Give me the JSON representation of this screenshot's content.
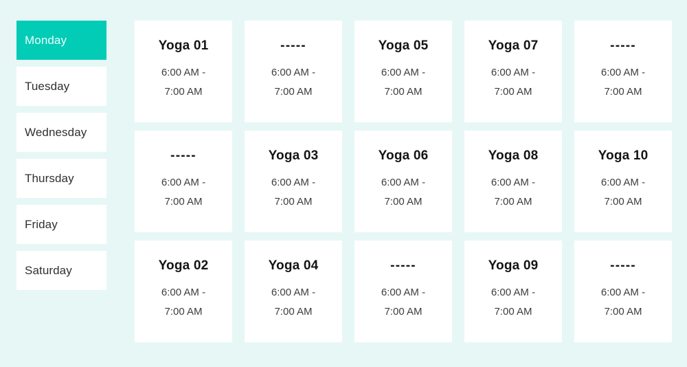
{
  "theme": {
    "background": "#e6f7f6",
    "accent": "#02cbb6",
    "card_background": "#ffffff",
    "title_color": "#131416",
    "time_color": "#3b3d40",
    "active_tab_text": "#eafffc"
  },
  "daybar": {
    "name": "day-selector",
    "selected": "Monday",
    "days": [
      {
        "label": "Monday",
        "active": true
      },
      {
        "label": "Tuesday",
        "active": false
      },
      {
        "label": "Wednesday",
        "active": false
      },
      {
        "label": "Thursday",
        "active": false
      },
      {
        "label": "Friday",
        "active": false
      },
      {
        "label": "Saturday",
        "active": false
      }
    ]
  },
  "schedule": {
    "name": "class-schedule-grid",
    "columns": 5,
    "rows": 3,
    "empty_label": "-----",
    "default_time": "6:00 AM - 7:00 AM",
    "cards": [
      {
        "title": "Yoga 01",
        "time_start": "6:00 AM -",
        "time_end": "7:00 AM",
        "empty": false
      },
      {
        "title": "-----",
        "time_start": "6:00 AM -",
        "time_end": "7:00 AM",
        "empty": true
      },
      {
        "title": "Yoga 05",
        "time_start": "6:00 AM -",
        "time_end": "7:00 AM",
        "empty": false
      },
      {
        "title": "Yoga 07",
        "time_start": "6:00 AM -",
        "time_end": "7:00 AM",
        "empty": false
      },
      {
        "title": "-----",
        "time_start": "6:00 AM -",
        "time_end": "7:00 AM",
        "empty": true
      },
      {
        "title": "-----",
        "time_start": "6:00 AM -",
        "time_end": "7:00 AM",
        "empty": true
      },
      {
        "title": "Yoga 03",
        "time_start": "6:00 AM -",
        "time_end": "7:00 AM",
        "empty": false
      },
      {
        "title": "Yoga 06",
        "time_start": "6:00 AM -",
        "time_end": "7:00 AM",
        "empty": false
      },
      {
        "title": "Yoga 08",
        "time_start": "6:00 AM -",
        "time_end": "7:00 AM",
        "empty": false
      },
      {
        "title": "Yoga 10",
        "time_start": "6:00 AM -",
        "time_end": "7:00 AM",
        "empty": false
      },
      {
        "title": "Yoga 02",
        "time_start": "6:00 AM -",
        "time_end": "7:00 AM",
        "empty": false
      },
      {
        "title": "Yoga 04",
        "time_start": "6:00 AM -",
        "time_end": "7:00 AM",
        "empty": false
      },
      {
        "title": "-----",
        "time_start": "6:00 AM -",
        "time_end": "7:00 AM",
        "empty": true
      },
      {
        "title": "Yoga 09",
        "time_start": "6:00 AM -",
        "time_end": "7:00 AM",
        "empty": false
      },
      {
        "title": "-----",
        "time_start": "6:00 AM -",
        "time_end": "7:00 AM",
        "empty": true
      }
    ]
  }
}
